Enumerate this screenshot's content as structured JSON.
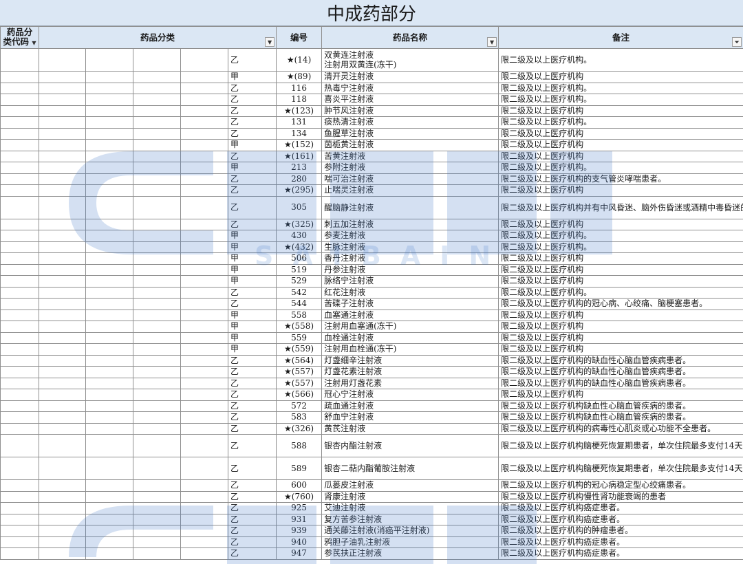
{
  "title": "中成药部分",
  "headers": {
    "code": "药品分类代码",
    "category": "药品分类",
    "number": "编号",
    "name": "药品名称",
    "note": "备注"
  },
  "watermark_text": "SAIBAIN",
  "rows": [
    {
      "cat": "乙",
      "num": "★(14)",
      "name": "双黄连注射液\n注射用双黄连(冻干)",
      "note": "限二级及以上医疗机构。",
      "tall": true
    },
    {
      "cat": "甲",
      "num": "★(89)",
      "name": "清开灵注射液",
      "note": "限二级及以上医疗机构"
    },
    {
      "cat": "乙",
      "num": "116",
      "name": "热毒宁注射液",
      "note": "限二级及以上医疗机构。"
    },
    {
      "cat": "乙",
      "num": "118",
      "name": "喜炎平注射液",
      "note": "限二级及以上医疗机构。"
    },
    {
      "cat": "乙",
      "num": "★(123)",
      "name": "肿节风注射液",
      "note": "限二级及以上医疗机构"
    },
    {
      "cat": "乙",
      "num": "131",
      "name": "痰热清注射液",
      "note": "限二级及以上医疗机构。"
    },
    {
      "cat": "乙",
      "num": "134",
      "name": "鱼腥草注射液",
      "note": "限二级及以上医疗机构"
    },
    {
      "cat": "甲",
      "num": "★(152)",
      "name": "茵栀黄注射液",
      "note": "限二级及以上医疗机构"
    },
    {
      "cat": "乙",
      "num": "★(161)",
      "name": "苦黄注射液",
      "note": "限二级及以上医疗机构"
    },
    {
      "cat": "甲",
      "num": "213",
      "name": "参附注射液",
      "note": "限二级及以上医疗机构。"
    },
    {
      "cat": "乙",
      "num": "280",
      "name": "喘可治注射液",
      "note": "限二级及以上医疗机构的支气管炎哮喘患者。"
    },
    {
      "cat": "乙",
      "num": "★(295)",
      "name": "止喘灵注射液",
      "note": "限二级及以上医疗机构"
    },
    {
      "cat": "乙",
      "num": "305",
      "name": "醒脑静注射液",
      "note": "限二级及以上医疗机构并有中风昏迷、脑外伤昏迷或酒精中毒昏迷的患者。",
      "tall": true
    },
    {
      "cat": "乙",
      "num": "★(325)",
      "name": "刺五加注射液",
      "note": "限二级及以上医疗机构"
    },
    {
      "cat": "甲",
      "num": "430",
      "name": "参麦注射液",
      "note": "限二级及以上医疗机构。"
    },
    {
      "cat": "甲",
      "num": "★(432)",
      "name": "生脉注射液",
      "note": "限二级及以上医疗机构。"
    },
    {
      "cat": "甲",
      "num": "506",
      "name": "香丹注射液",
      "note": "限二级及以上医疗机构"
    },
    {
      "cat": "甲",
      "num": "519",
      "name": "丹参注射液",
      "note": "限二级及以上医疗机构"
    },
    {
      "cat": "甲",
      "num": "529",
      "name": "脉络宁注射液",
      "note": "限二级及以上医疗机构"
    },
    {
      "cat": "乙",
      "num": "542",
      "name": "红花注射液",
      "note": "限二级及以上医疗机构。"
    },
    {
      "cat": "乙",
      "num": "544",
      "name": "苦碟子注射液",
      "note": "限二级及以上医疗机构的冠心病、心绞痛、脑梗塞患者。"
    },
    {
      "cat": "甲",
      "num": "558",
      "name": "血塞通注射液",
      "note": "限二级及以上医疗机构"
    },
    {
      "cat": "甲",
      "num": "★(558)",
      "name": "注射用血塞通(冻干)",
      "note": "限二级及以上医疗机构"
    },
    {
      "cat": "甲",
      "num": "559",
      "name": "血栓通注射液",
      "note": "限二级及以上医疗机构"
    },
    {
      "cat": "甲",
      "num": "★(559)",
      "name": "注射用血栓通(冻干)",
      "note": "限二级及以上医疗机构"
    },
    {
      "cat": "乙",
      "num": "★(564)",
      "name": "灯盏细辛注射液",
      "note": "限二级及以上医疗机构的缺血性心脑血管疾病患者。"
    },
    {
      "cat": "乙",
      "num": "★(557)",
      "name": "灯盏花素注射液",
      "note": "限二级及以上医疗机构的缺血性心脑血管疾病患者。"
    },
    {
      "cat": "乙",
      "num": "★(557)",
      "name": "注射用灯盏花素",
      "note": "限二级及以上医疗机构的缺血性心脑血管疾病患者。"
    },
    {
      "cat": "乙",
      "num": "★(566)",
      "name": "冠心宁注射液",
      "note": "限二级及以上医疗机构"
    },
    {
      "cat": "乙",
      "num": "572",
      "name": "疏血通注射液",
      "note": "限二级及以上医疗机构缺血性心脑血管疾病的患者。"
    },
    {
      "cat": "乙",
      "num": "583",
      "name": "舒血宁注射液",
      "note": "限二级及以上医疗机构缺血性心脑血管疾病的患者。"
    },
    {
      "cat": "乙",
      "num": "★(326)",
      "name": "黄芪注射液",
      "note": "限二级及以上医疗机构的病毒性心肌炎或心功能不全患者。"
    },
    {
      "cat": "乙",
      "num": "588",
      "name": "银杏内酯注射液",
      "note": "限二级及以上医疗机构脑梗死恢复期患者，单次住院最多支付14天。",
      "tall": true
    },
    {
      "cat": "乙",
      "num": "589",
      "name": "银杏二萜内酯葡胺注射液",
      "note": "限二级及以上医疗机构脑梗死恢复期患者，单次住院最多支付14天。",
      "tall": true
    },
    {
      "cat": "乙",
      "num": "600",
      "name": "瓜蒌皮注射液",
      "note": "限二级及以上医疗机构的冠心病稳定型心绞痛患者。"
    },
    {
      "cat": "乙",
      "num": "★(760)",
      "name": "肾康注射液",
      "note": "限二级及以上医疗机构慢性肾功能衰竭的患者"
    },
    {
      "cat": "乙",
      "num": "925",
      "name": "艾迪注射液",
      "note": "限二级及以上医疗机构癌症患者。"
    },
    {
      "cat": "乙",
      "num": "931",
      "name": "复方苦参注射液",
      "note": "限二级及以上医疗机构癌症患者。"
    },
    {
      "cat": "乙",
      "num": "939",
      "name": "通关藤注射液(消癌平注射液)",
      "note": "限二级及以上医疗机构的肿瘤患者。"
    },
    {
      "cat": "乙",
      "num": "940",
      "name": "鸦胆子油乳注射液",
      "note": "限二级及以上医疗机构癌症患者。"
    },
    {
      "cat": "乙",
      "num": "947",
      "name": "参芪扶正注射液",
      "note": "限二级及以上医疗机构癌症患者。"
    }
  ]
}
